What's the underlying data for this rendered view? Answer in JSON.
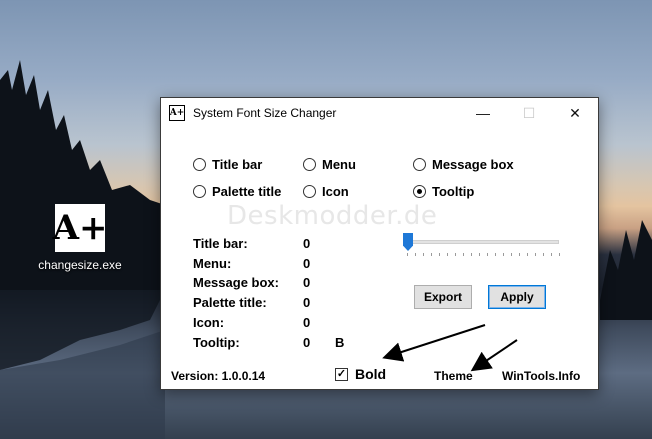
{
  "desktop": {
    "icon_glyph": "A+",
    "icon_label": "changesize.exe"
  },
  "window": {
    "app_icon_glyph": "A+",
    "title": "System Font Size Changer",
    "minimize_glyph": "—",
    "maximize_glyph": "☐",
    "close_glyph": "✕"
  },
  "radios": [
    {
      "label": "Title bar",
      "checked": false
    },
    {
      "label": "Menu",
      "checked": false
    },
    {
      "label": "Message box",
      "checked": false
    },
    {
      "label": "Palette title",
      "checked": false
    },
    {
      "label": "Icon",
      "checked": false
    },
    {
      "label": "Tooltip",
      "checked": true
    }
  ],
  "watermark": "Deskmodder.de",
  "sizes": [
    {
      "label": "Title bar:",
      "value": "0"
    },
    {
      "label": "Menu:",
      "value": "0"
    },
    {
      "label": "Message box:",
      "value": "0"
    },
    {
      "label": "Palette title:",
      "value": "0"
    },
    {
      "label": "Icon:",
      "value": "0"
    },
    {
      "label": "Tooltip:",
      "value": "0"
    }
  ],
  "tooltip_bold_indicator": "B",
  "slider": {
    "value_fraction": 0.0
  },
  "buttons": {
    "export": "Export",
    "apply": "Apply"
  },
  "bold_checkbox": {
    "label": "Bold",
    "checked": true
  },
  "footer": {
    "version": "Version: 1.0.0.14",
    "theme": "Theme",
    "site": "WinTools.Info"
  },
  "colors": {
    "accent": "#1e78d7",
    "arrow": "#000000"
  }
}
